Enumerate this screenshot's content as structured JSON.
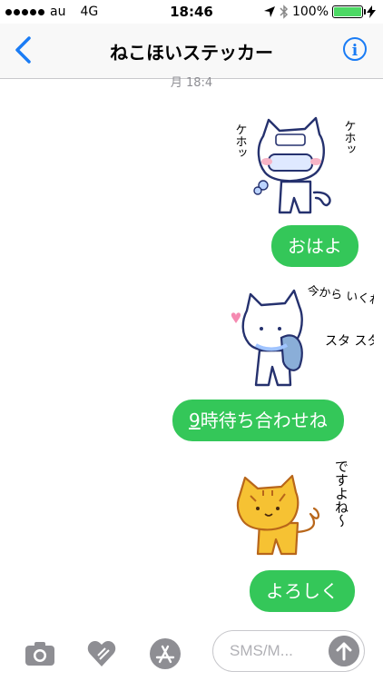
{
  "status_bar": {
    "carrier": "au",
    "network": "4G",
    "time": "18:46",
    "battery": "100%"
  },
  "nav": {
    "title": "ねこほいステッカー",
    "info_label": "i"
  },
  "timestamp": "月 18:4",
  "messages": [
    {
      "type": "sticker",
      "text1": "ケホッ",
      "text2": "ケホッ"
    },
    {
      "type": "text",
      "text": "おはよ"
    },
    {
      "type": "sticker",
      "text1": "今から いくね〜",
      "text2": "スタ スタ"
    },
    {
      "type": "text",
      "text_link": "9",
      "text_rest": "時待ち合わせね"
    },
    {
      "type": "sticker",
      "text1": "ですよね〜"
    },
    {
      "type": "text",
      "text": "よろしく"
    }
  ],
  "composer": {
    "placeholder": "SMS/M..."
  },
  "colors": {
    "bubble": "#34c759",
    "accent": "#1a7cf5"
  }
}
